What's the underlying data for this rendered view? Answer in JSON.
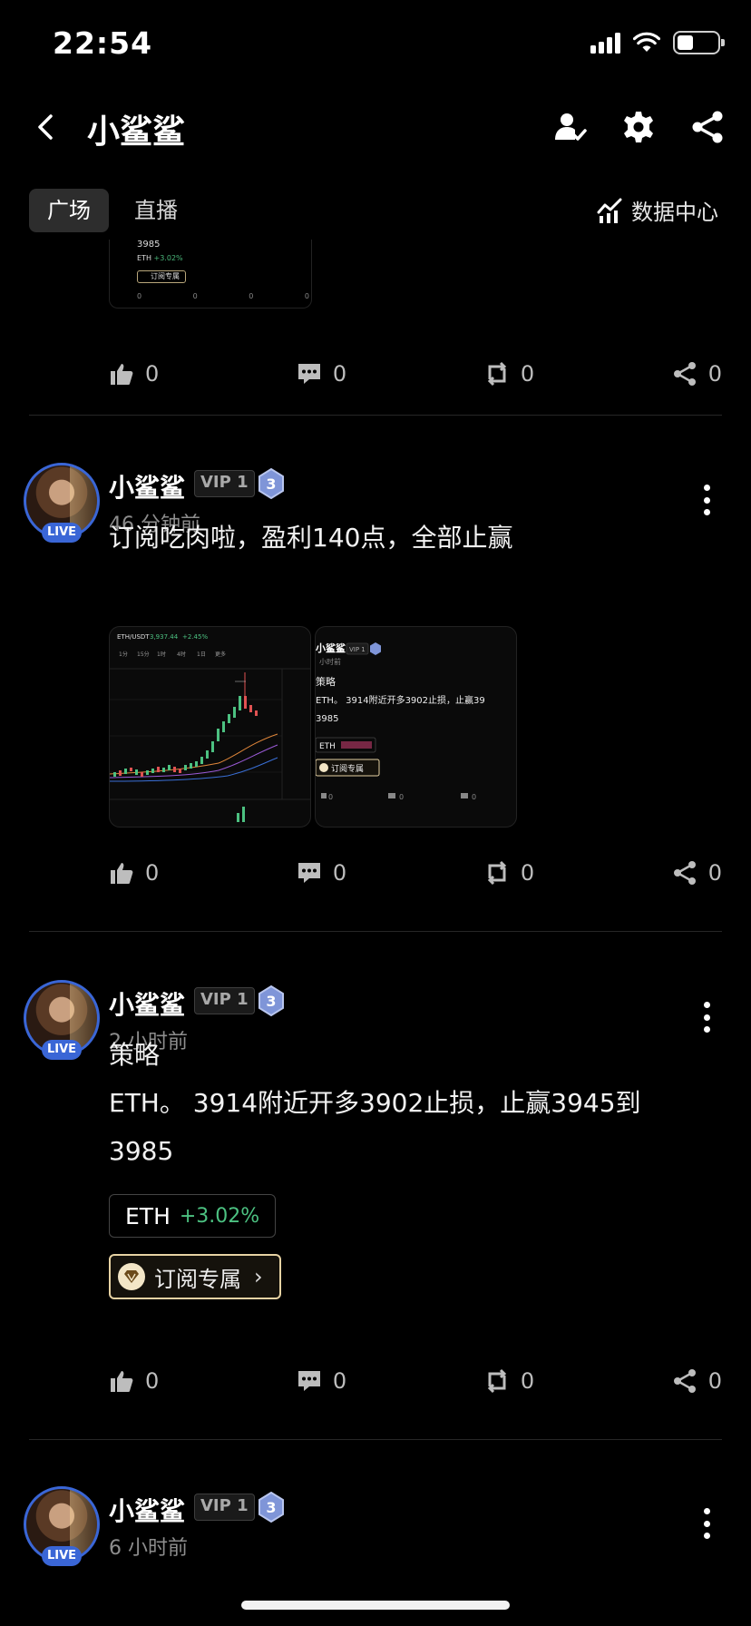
{
  "status_bar": {
    "time": "22:54"
  },
  "nav": {
    "title": "小鲨鲨"
  },
  "tabs": [
    {
      "label": "广场",
      "active": true
    },
    {
      "label": "直播",
      "active": false
    }
  ],
  "data_center": {
    "label": "数据中心"
  },
  "colors": {
    "live_blue": "#3a66d6",
    "gain_green": "#4cc181",
    "gold_border": "#e6d2a3",
    "background": "#000000"
  },
  "top_partial": {
    "mini_card": {
      "price": "3985",
      "tag": "ETH",
      "change": "+3.02%",
      "badge": "订阅专属",
      "actions": [
        "0",
        "0",
        "0",
        "0"
      ]
    },
    "actions": {
      "like": "0",
      "comment": "0",
      "repost": "0",
      "share": "0"
    }
  },
  "posts": [
    {
      "author": "小鲨鲨",
      "vip": "VIP 1",
      "level": "3",
      "live": "LIVE",
      "time": "46 分钟前",
      "content": "订阅吃肉啦，盈利140点，全部止赢",
      "images": [
        {
          "kind": "chart",
          "pair": "ETH/USDT",
          "price": "3,937.44",
          "change": "+2.45%",
          "tf": [
            "1分",
            "15分",
            "1时",
            "4时",
            "1日",
            "更多"
          ]
        },
        {
          "kind": "post-preview",
          "author": "小鲨鲨",
          "vip": "VIP 1",
          "time": "小时前",
          "title": "策略",
          "body": "ETH。 3914附近开多3902止损，止赢39",
          "price": "3985",
          "tag": "ETH",
          "badge": "订阅专属",
          "actions": [
            "0",
            "0",
            "0"
          ]
        }
      ],
      "actions": {
        "like": "0",
        "comment": "0",
        "repost": "0",
        "share": "0"
      }
    },
    {
      "author": "小鲨鲨",
      "vip": "VIP 1",
      "level": "3",
      "live": "LIVE",
      "time": "2 小时前",
      "content": "策略\nETH。 3914附近开多3902止损，止赢3945到\n3985",
      "ticker": {
        "symbol": "ETH",
        "change": "+3.02%"
      },
      "subscribe": "订阅专属",
      "actions": {
        "like": "0",
        "comment": "0",
        "repost": "0",
        "share": "0"
      }
    },
    {
      "author": "小鲨鲨",
      "vip": "VIP 1",
      "level": "3",
      "live": "LIVE",
      "time": "6 小时前"
    }
  ]
}
